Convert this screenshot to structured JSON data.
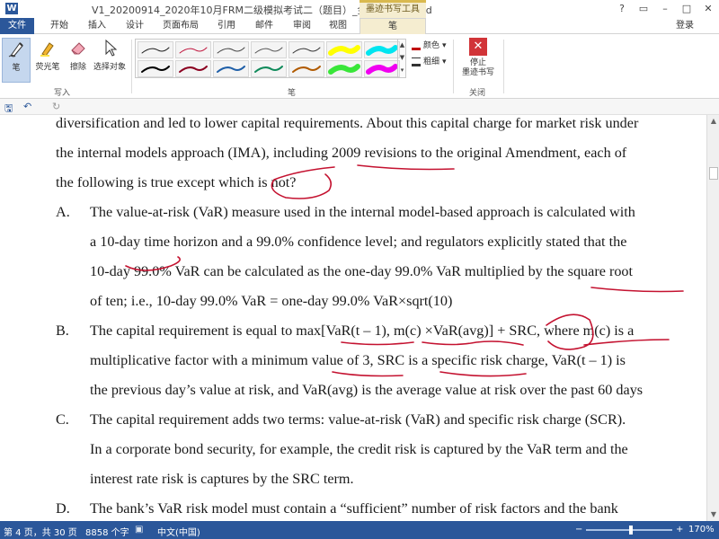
{
  "window": {
    "title": "V1_20200914_2020年10月FRM二级模拟考试二（题目）_金程教育 - Word",
    "context_tab_title": "墨迹书写工具",
    "controls": {
      "help": "?",
      "restore": "▭",
      "minimize": "–",
      "maximize": "□",
      "close": "✕"
    }
  },
  "tabs": [
    {
      "label": "文件"
    },
    {
      "label": "开始"
    },
    {
      "label": "插入"
    },
    {
      "label": "设计"
    },
    {
      "label": "页面布局"
    },
    {
      "label": "引用"
    },
    {
      "label": "邮件"
    },
    {
      "label": "审阅"
    },
    {
      "label": "视图"
    },
    {
      "label": "笔"
    }
  ],
  "login": "登录",
  "ribbon": {
    "tools": {
      "pen": "笔",
      "highlighter": "荧光笔",
      "eraser": "擦除",
      "select": "选择对象"
    },
    "write_group_label": "写入",
    "pen_group_label": "笔",
    "close_group_label": "关闭",
    "color_label": "颜色",
    "weight_label": "粗细",
    "stop_label_1": "停止",
    "stop_label_2": "墨迹书写",
    "pen_swatches": [
      {
        "color": "#1a1a1a",
        "stroke": 1
      },
      {
        "color": "#c0143c",
        "stroke": 1
      },
      {
        "color": "#444444",
        "stroke": 1
      },
      {
        "color": "#555555",
        "stroke": 1
      },
      {
        "color": "#333333",
        "stroke": 1
      },
      {
        "color": "#ffff00",
        "stroke": 6
      },
      {
        "color": "#00e5f0",
        "stroke": 6
      },
      {
        "color": "#000000",
        "stroke": 2
      },
      {
        "color": "#8b0020",
        "stroke": 2
      },
      {
        "color": "#1f5fa8",
        "stroke": 2
      },
      {
        "color": "#0f8a5a",
        "stroke": 2
      },
      {
        "color": "#b05a00",
        "stroke": 2
      },
      {
        "color": "#39e639",
        "stroke": 6
      },
      {
        "color": "#f000f0",
        "stroke": 6
      }
    ]
  },
  "quickbar": {
    "save": "🖫",
    "undo": "↶",
    "redo": "↻"
  },
  "document": {
    "lines": [
      "diversification and led to lower capital requirements. About this capital charge for market risk under",
      "the internal models approach (IMA), including 2009 revisions to the original Amendment, each of",
      "the following is true except which is not?",
      "The value-at-risk (VaR) measure used in the internal model-based approach is calculated with",
      "a 10-day time horizon and a 99.0% confidence level; and regulators explicitly stated that the",
      "10-day 99.0% VaR can be calculated as the one-day 99.0% VaR multiplied by the square root",
      "of ten; i.e., 10-day 99.0% VaR = one-day 99.0% VaR×sqrt(10)",
      "The capital requirement is equal to max[VaR(t – 1), m(c) ×VaR(avg)] + SRC, where m(c) is a",
      "multiplicative factor with a minimum value of 3, SRC is a specific risk charge, VaR(t – 1) is",
      "the previous day’s value at risk, and VaR(avg) is the average value at risk over the past 60 days",
      "The capital requirement adds two terms: value-at-risk (VaR) and specific risk charge (SCR).",
      "In a corporate bond security, for example, the credit risk is captured by the VaR term and the",
      "interest rate risk is captures by the SRC term.",
      "The bank’s VaR risk model must contain a “sufficient” number of risk factors and the bank"
    ],
    "markers": [
      "A.",
      "B.",
      "C.",
      "D."
    ],
    "ink_color": "#c41230"
  },
  "statusbar": {
    "page": "第 4 页，共 30 页",
    "words": "8858 个字",
    "lang_icon": "▣",
    "language": "中文(中国)",
    "zoom_minus": "−",
    "zoom_plus": "+",
    "zoom": "170%"
  }
}
